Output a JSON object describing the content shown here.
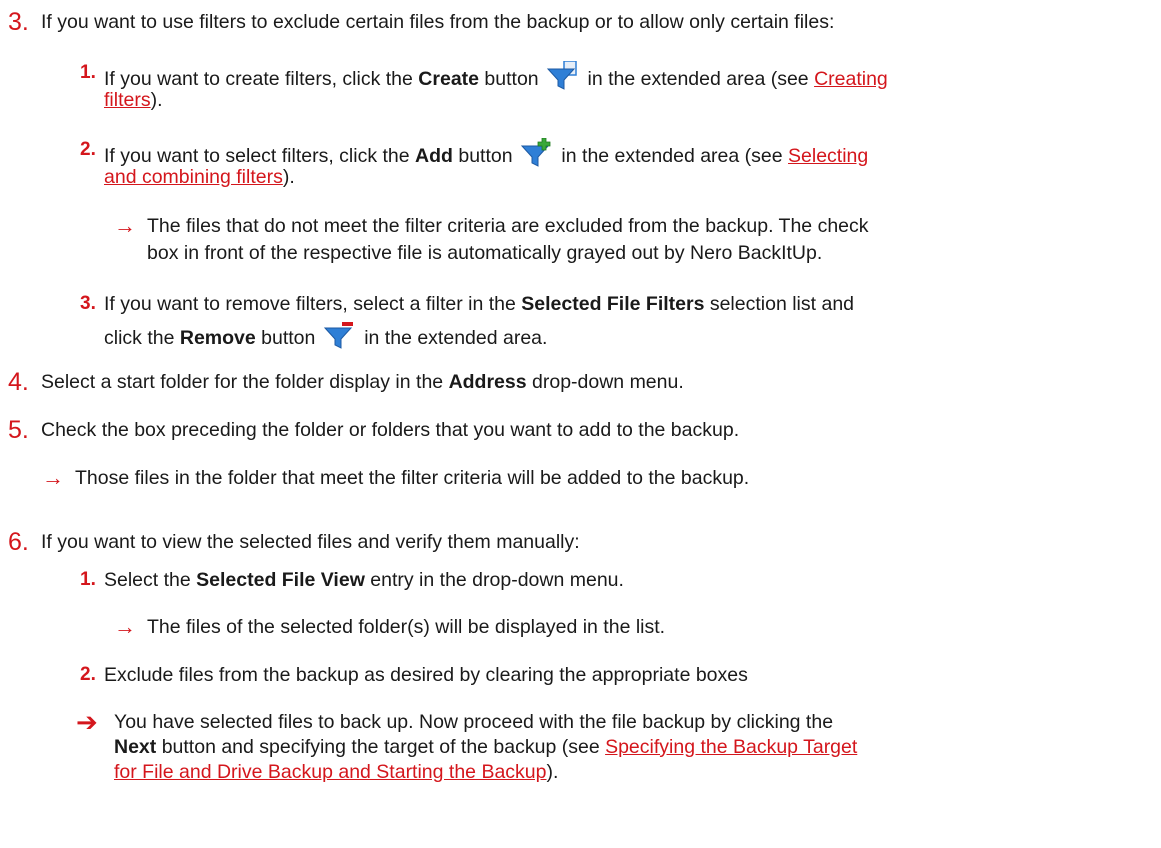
{
  "item3": {
    "num": "3.",
    "text": "If you want to use filters to exclude certain files from the backup or to allow only certain files:",
    "sub1": {
      "num": "1.",
      "a": "If you want to create filters, click the ",
      "bold": "Create",
      "b": " button",
      "c": " in the extended area (see ",
      "link1": "Creating",
      "link2": "filters",
      "d": ").",
      "icon": "filter-create-icon"
    },
    "sub2": {
      "num": "2.",
      "a": "If you want to select filters, click the ",
      "bold": "Add",
      "b": " button",
      "c": " in the extended area (see ",
      "link1": "Selecting",
      "link2": "and combining filters",
      "d": ").",
      "icon": "filter-add-icon",
      "result_line1": "The files that do not meet the filter criteria are excluded from the backup. The check",
      "result_line2": "box in front of the respective file is automatically grayed out by Nero BackItUp."
    },
    "sub3": {
      "num": "3.",
      "a": "If you want to remove filters, select a filter in the ",
      "bold": "Selected File Filters",
      "b": " selection list and",
      "c": "click the ",
      "bold2": "Remove",
      "d": " button",
      "e": " in the extended area.",
      "icon": "filter-remove-icon"
    }
  },
  "item4": {
    "num": "4.",
    "a": "Select a start folder for the folder display in the ",
    "bold": "Address",
    "b": " drop-down menu."
  },
  "item5": {
    "num": "5.",
    "text": "Check the box preceding the folder or folders that you want to add to the backup.",
    "result": "Those files in the folder that meet the filter criteria will be added to the backup."
  },
  "item6": {
    "num": "6.",
    "text": "If you want to view the selected files and verify them manually:",
    "sub1": {
      "num": "1.",
      "a": "Select the ",
      "bold": "Selected File View",
      "b": " entry in the drop-down menu.",
      "result": "The files of the selected folder(s) will be displayed in the list."
    },
    "sub2": {
      "num": "2.",
      "text": "Exclude files from the backup as desired by clearing the appropriate boxes"
    }
  },
  "final": {
    "line1": "You have selected files to back up. Now proceed with the file backup by clicking the",
    "bold": "Next",
    "line2a": " button and specifying the target of the backup (see ",
    "link_a": "Specifying the Backup Target",
    "link_b": "for File and Drive Backup and Starting the Backup",
    "line3b": ")."
  },
  "symbols": {
    "arrow": "→",
    "arrow_bold": "➔"
  },
  "colors": {
    "accent": "#d4161c",
    "text": "#1a1a1a",
    "icon_blue": "#2f7fd6"
  }
}
